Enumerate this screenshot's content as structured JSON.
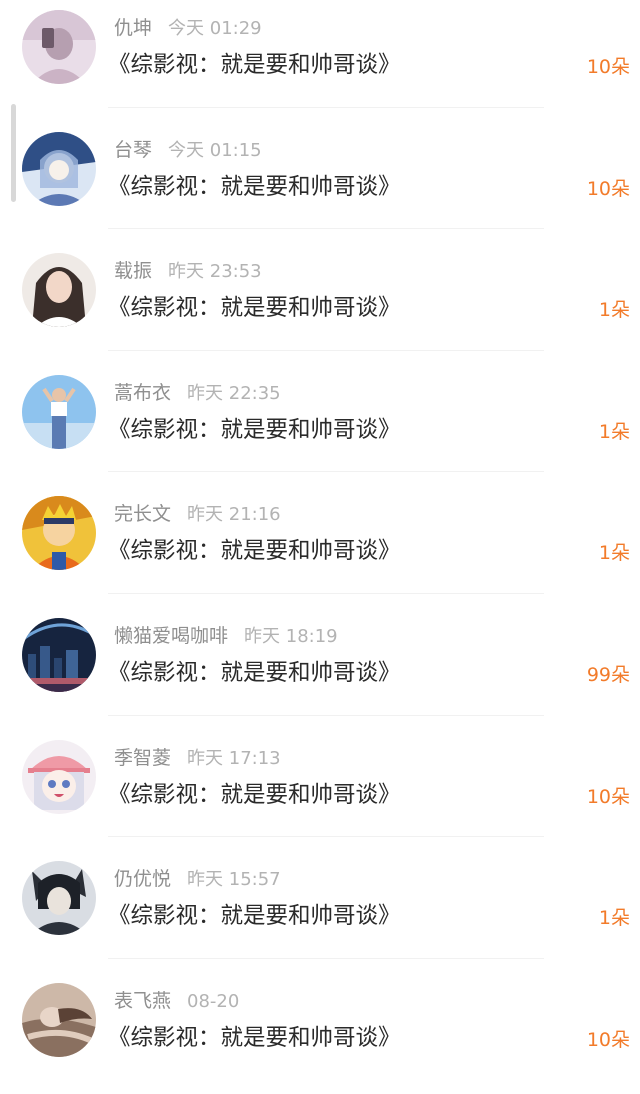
{
  "colors": {
    "name": "#8f8f8f",
    "time": "#b3b3b3",
    "title": "#2a2a2a",
    "count": "#f27b2a",
    "divider": "#f1f1f1"
  },
  "items": [
    {
      "name": "仇坤",
      "time": "今天 01:29",
      "title": "《综影视：就是要和帅哥谈》",
      "count": "10朵",
      "avatar": "avatar-girl-selfie"
    },
    {
      "name": "台琴",
      "time": "今天 01:15",
      "title": "《综影视：就是要和帅哥谈》",
      "count": "10朵",
      "avatar": "avatar-anime-girl"
    },
    {
      "name": "载振",
      "time": "昨天 23:53",
      "title": "《综影视：就是要和帅哥谈》",
      "count": "1朵",
      "avatar": "avatar-girl-portrait"
    },
    {
      "name": "蒿布衣",
      "time": "昨天 22:35",
      "title": "《综影视：就是要和帅哥谈》",
      "count": "1朵",
      "avatar": "avatar-girl-sky"
    },
    {
      "name": "完长文",
      "time": "昨天 21:16",
      "title": "《综影视：就是要和帅哥谈》",
      "count": "1朵",
      "avatar": "avatar-cartoon-ninja"
    },
    {
      "name": "懒猫爱喝咖啡",
      "time": "昨天 18:19",
      "title": "《综影视：就是要和帅哥谈》",
      "count": "99朵",
      "avatar": "avatar-city-night"
    },
    {
      "name": "季智菱",
      "time": "昨天 17:13",
      "title": "《综影视：就是要和帅哥谈》",
      "count": "10朵",
      "avatar": "avatar-anime-cap"
    },
    {
      "name": "仍优悦",
      "time": "昨天 15:57",
      "title": "《综影视：就是要和帅哥谈》",
      "count": "1朵",
      "avatar": "avatar-dark-anime"
    },
    {
      "name": "表飞燕",
      "time": "08-20",
      "title": "《综影视：就是要和帅哥谈》",
      "count": "10朵",
      "avatar": "avatar-reclining"
    }
  ]
}
